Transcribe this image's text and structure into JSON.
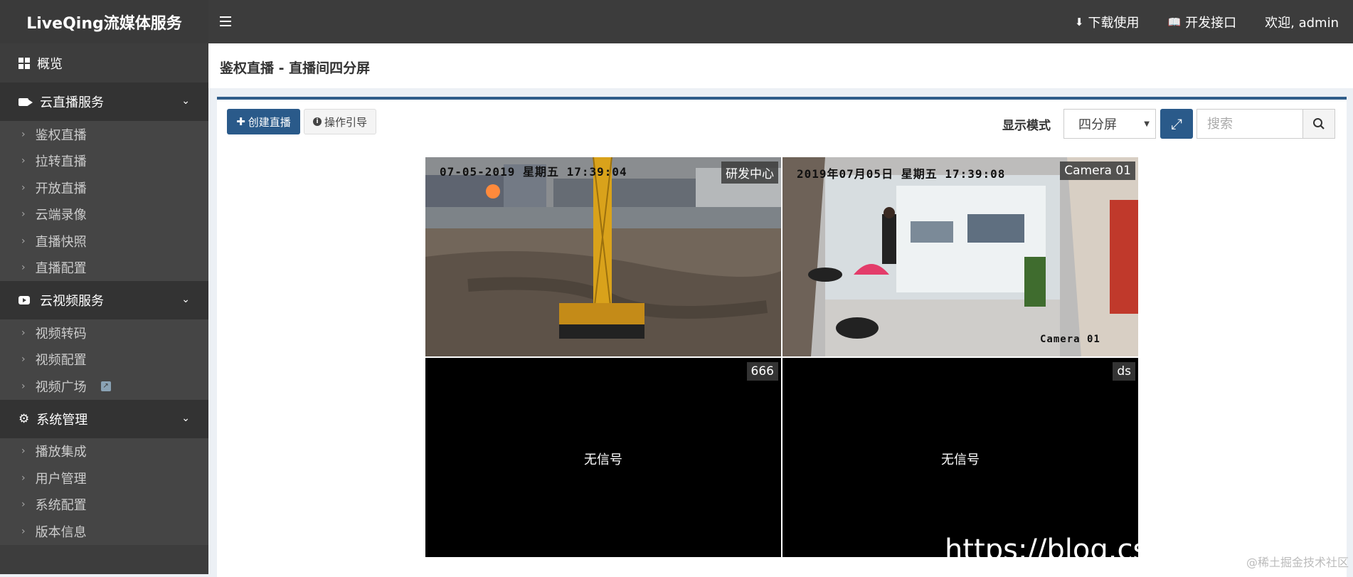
{
  "app": {
    "title": "LiveQing流媒体服务"
  },
  "topnav": {
    "download": "下载使用",
    "api": "开发接口",
    "welcome": "欢迎, admin"
  },
  "sidebar": {
    "overview": "概览",
    "groups": [
      {
        "label": "云直播服务",
        "items": [
          "鉴权直播",
          "拉转直播",
          "开放直播",
          "云端录像",
          "直播快照",
          "直播配置"
        ]
      },
      {
        "label": "云视频服务",
        "items": [
          "视频转码",
          "视频配置",
          "视频广场"
        ]
      },
      {
        "label": "系统管理",
        "items": [
          "播放集成",
          "用户管理",
          "系统配置",
          "版本信息"
        ]
      }
    ]
  },
  "page": {
    "title": "鉴权直播 - 直播间四分屏"
  },
  "toolbar": {
    "create_label": "创建直播",
    "guide_label": "操作引导",
    "mode_label": "显示模式",
    "mode_value": "四分屏",
    "search_placeholder": "搜索"
  },
  "tiles": [
    {
      "label": "研发中心",
      "osd": "07-05-2019  星期五  17:39:04"
    },
    {
      "label": "Camera 01",
      "osd": "2019年07月05日  星期五  17:39:08",
      "osd2": "Camera 01"
    },
    {
      "label": "666",
      "status": "无信号"
    },
    {
      "label": "ds",
      "status": "无信号"
    }
  ],
  "watermark": {
    "url": "https://blog.csdr",
    "corner": "@稀土掘金技术社区"
  },
  "colors": {
    "topbar": "#3c3c3c",
    "sidebar": "#3d3d3d",
    "primary": "#2a5a8a"
  }
}
